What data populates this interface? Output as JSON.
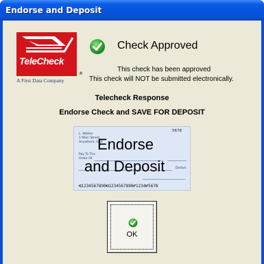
{
  "window": {
    "title": "Endorse and Deposit"
  },
  "logo": {
    "brand": "TeleCheck",
    "registered": "®",
    "tagline": "A First Data Company"
  },
  "status": {
    "heading": "Check Approved",
    "line1": "This check has been approved",
    "line2": "This check will NOT be submitted electronically."
  },
  "response": {
    "heading": "Telecheck Response",
    "instruction": "Endorse Check and SAVE FOR DEPOSIT"
  },
  "check_image": {
    "overlay_line1": "Endorse",
    "overlay_line2": "and Deposit",
    "number": "5678",
    "payer_line1": "L. Walker",
    "payer_line2": "1 Main Street",
    "payer_line3": "Anywhere, USA",
    "pay_to_label": "Pay To The",
    "order_of_label": "Order Of",
    "dollars_label": "Dollars",
    "micr_line": "⑆1234567890⑆1234567890⑈1234⑈5678"
  },
  "buttons": {
    "ok_label": "OK"
  },
  "colors": {
    "titlebar": "#0553e0",
    "client_bg": "#ece9d8",
    "logo_red": "#d4141b",
    "check_green": "#2fa83a"
  },
  "icons": {
    "approved": "green-checkmark-icon",
    "ok": "green-checkmark-icon"
  }
}
